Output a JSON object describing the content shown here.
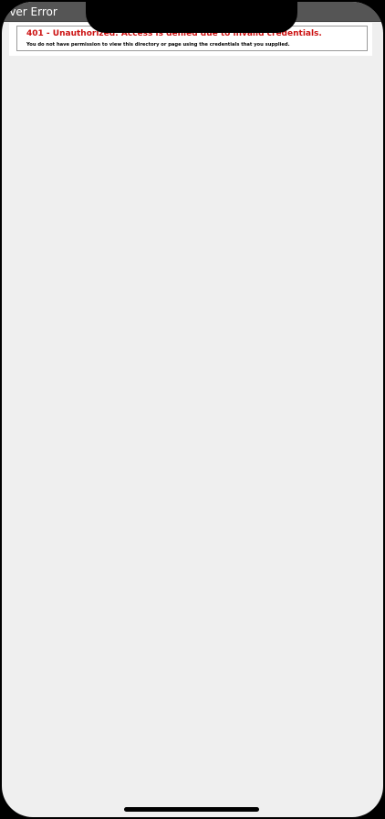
{
  "header": {
    "title": "erver Error"
  },
  "error": {
    "title": "401 - Unauthorized: Access is denied due to invalid credentials.",
    "detail": "You do not have permission to view this directory or page using the credentials that you supplied."
  },
  "colors": {
    "header_bg": "#555555",
    "error_red": "#cc1111",
    "page_bg": "#efefef"
  }
}
